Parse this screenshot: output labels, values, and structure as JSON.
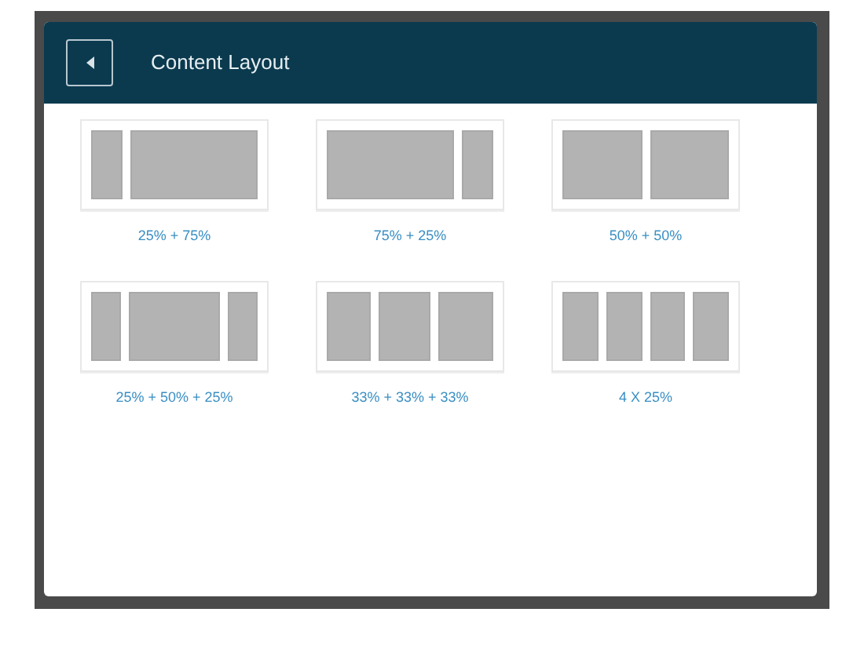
{
  "dialog": {
    "title": "Content Layout"
  },
  "layouts": [
    {
      "kind": "quarter-threequarter",
      "label": "25% + 75%"
    },
    {
      "kind": "threequarter-quarter",
      "label": "75% + 25%"
    },
    {
      "kind": "half-half",
      "label": "50% + 50%"
    },
    {
      "kind": "quarter-half-quarter",
      "label": "25% + 50% + 25%"
    },
    {
      "kind": "thirds",
      "label": "33% + 33% + 33%"
    },
    {
      "kind": "quarters",
      "label": "4 X 25%"
    }
  ]
}
